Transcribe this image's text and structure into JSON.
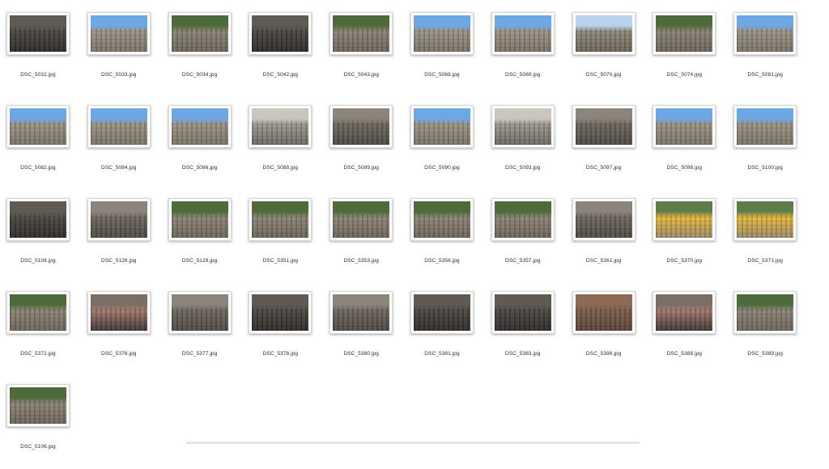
{
  "files": [
    {
      "name": "DSC_5032.jpg",
      "tone": "stone-dark"
    },
    {
      "name": "DSC_5033.jpg",
      "tone": "sky"
    },
    {
      "name": "DSC_5034.jpg",
      "tone": "forest"
    },
    {
      "name": "DSC_5042.jpg",
      "tone": "stone-dark"
    },
    {
      "name": "DSC_5043.jpg",
      "tone": "forest"
    },
    {
      "name": "DSC_5068.jpg",
      "tone": "sky"
    },
    {
      "name": "DSC_5069.jpg",
      "tone": "sky"
    },
    {
      "name": "DSC_5070.jpg",
      "tone": "sky-light"
    },
    {
      "name": "DSC_5074.jpg",
      "tone": "forest"
    },
    {
      "name": "DSC_5081.jpg",
      "tone": "sky"
    },
    {
      "name": "DSC_5082.jpg",
      "tone": "sky"
    },
    {
      "name": "DSC_5084.jpg",
      "tone": "sky"
    },
    {
      "name": "DSC_5086.jpg",
      "tone": "sky"
    },
    {
      "name": "DSC_5088.jpg",
      "tone": "stone-light"
    },
    {
      "name": "DSC_5089.jpg",
      "tone": "stone"
    },
    {
      "name": "DSC_5090.jpg",
      "tone": "sky"
    },
    {
      "name": "DSC_5093.jpg",
      "tone": "stone-light"
    },
    {
      "name": "DSC_5097.jpg",
      "tone": "stone"
    },
    {
      "name": "DSC_5098.jpg",
      "tone": "sky"
    },
    {
      "name": "DSC_5100.jpg",
      "tone": "sky"
    },
    {
      "name": "DSC_5108.jpg",
      "tone": "stone-dark"
    },
    {
      "name": "DSC_5126.jpg",
      "tone": "stone"
    },
    {
      "name": "DSC_5128.jpg",
      "tone": "forest"
    },
    {
      "name": "DSC_5351.jpg",
      "tone": "forest"
    },
    {
      "name": "DSC_5353.jpg",
      "tone": "forest"
    },
    {
      "name": "DSC_5356.jpg",
      "tone": "forest"
    },
    {
      "name": "DSC_5357.jpg",
      "tone": "forest"
    },
    {
      "name": "DSC_5361.jpg",
      "tone": "stone"
    },
    {
      "name": "DSC_5370.jpg",
      "tone": "yellow"
    },
    {
      "name": "DSC_5371.jpg",
      "tone": "yellow"
    },
    {
      "name": "DSC_5372.jpg",
      "tone": "forest"
    },
    {
      "name": "DSC_5376.jpg",
      "tone": "wall"
    },
    {
      "name": "DSC_5377.jpg",
      "tone": "stone"
    },
    {
      "name": "DSC_5378.jpg",
      "tone": "stone-dark"
    },
    {
      "name": "DSC_5380.jpg",
      "tone": "stone"
    },
    {
      "name": "DSC_5381.jpg",
      "tone": "stone-dark"
    },
    {
      "name": "DSC_5383.jpg",
      "tone": "stone-dark"
    },
    {
      "name": "DSC_5386.jpg",
      "tone": "brick"
    },
    {
      "name": "DSC_5388.jpg",
      "tone": "wall"
    },
    {
      "name": "DSC_5389.jpg",
      "tone": "forest"
    },
    {
      "name": "DSC_5106.jpg",
      "tone": "forest"
    }
  ],
  "tones": {
    "sky": {
      "top": "#6ea8e4",
      "bottom": "#7d7466",
      "mid": "#9a9183"
    },
    "sky-light": {
      "top": "#b9d3ef",
      "bottom": "#6f675b",
      "mid": "#8e8576"
    },
    "forest": {
      "top": "#4d6a3a",
      "bottom": "#6d665a",
      "mid": "#8a8375"
    },
    "stone": {
      "top": "#8b847a",
      "bottom": "#4f4a44",
      "mid": "#6c665e"
    },
    "stone-dark": {
      "top": "#5f5a54",
      "bottom": "#2f2c29",
      "mid": "#4a4641"
    },
    "stone-light": {
      "top": "#c9c5bf",
      "bottom": "#6e6a64",
      "mid": "#9b968f"
    },
    "yellow": {
      "top": "#5e7c4a",
      "bottom": "#9b8a6a",
      "mid": "#e3b63a"
    },
    "wall": {
      "top": "#7a6f66",
      "bottom": "#3e3934",
      "mid": "#a2766a"
    },
    "brick": {
      "top": "#8c6a55",
      "bottom": "#5c4537",
      "mid": "#7a5c4a"
    }
  }
}
